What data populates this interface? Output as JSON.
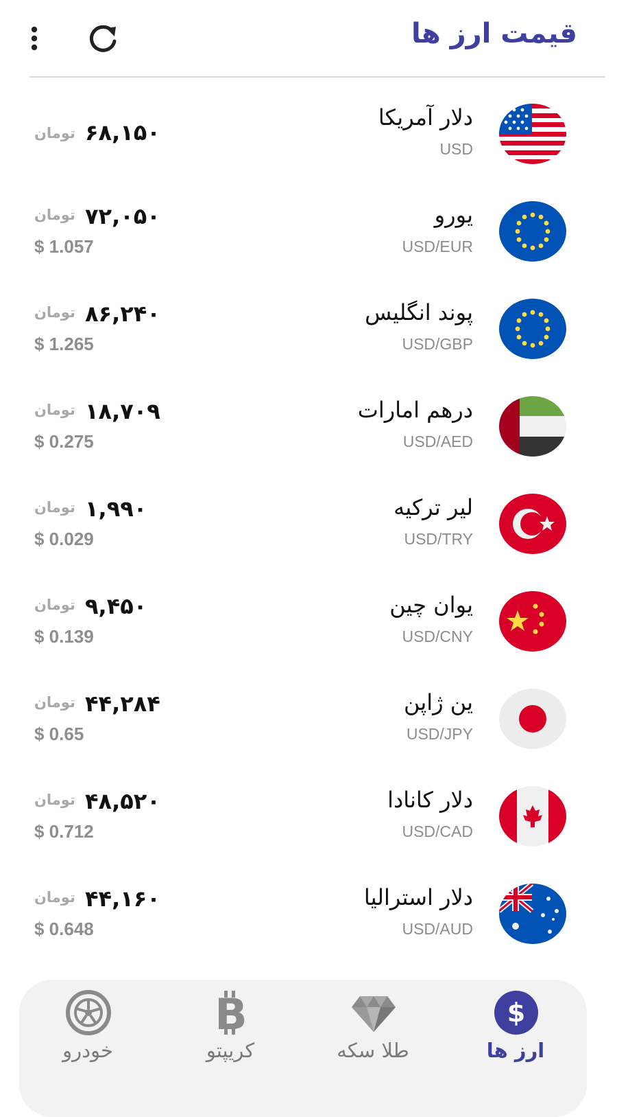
{
  "header": {
    "title": "قیمت ارز ها"
  },
  "currencies": [
    {
      "name": "دلار آمریکا",
      "code": "USD",
      "price": "۶۸,۱۵۰",
      "unit": "تومان",
      "usd": ""
    },
    {
      "name": "یورو",
      "code": "USD/EUR",
      "price": "۷۲,۰۵۰",
      "unit": "تومان",
      "usd": "$ 1.057"
    },
    {
      "name": "پوند انگلیس",
      "code": "USD/GBP",
      "price": "۸۶,۲۴۰",
      "unit": "تومان",
      "usd": "$ 1.265"
    },
    {
      "name": "درهم امارات",
      "code": "USD/AED",
      "price": "۱۸,۷۰۹",
      "unit": "تومان",
      "usd": "$ 0.275"
    },
    {
      "name": "لیر ترکیه",
      "code": "USD/TRY",
      "price": "۱,۹۹۰",
      "unit": "تومان",
      "usd": "$ 0.029"
    },
    {
      "name": "یوان چین",
      "code": "USD/CNY",
      "price": "۹,۴۵۰",
      "unit": "تومان",
      "usd": "$ 0.139"
    },
    {
      "name": "ین ژاپن",
      "code": "USD/JPY",
      "price": "۴۴,۲۸۴",
      "unit": "تومان",
      "usd": "$ 0.65"
    },
    {
      "name": "دلار کانادا",
      "code": "USD/CAD",
      "price": "۴۸,۵۲۰",
      "unit": "تومان",
      "usd": "$ 0.712"
    },
    {
      "name": "دلار استرالیا",
      "code": "USD/AUD",
      "price": "۴۴,۱۶۰",
      "unit": "تومان",
      "usd": "$ 0.648"
    }
  ],
  "flags": [
    "us-flag-icon",
    "eu-flag-icon",
    "eu-flag-icon",
    "uae-flag-icon",
    "turkey-flag-icon",
    "china-flag-icon",
    "japan-flag-icon",
    "canada-flag-icon",
    "australia-flag-icon"
  ],
  "bottom_nav": [
    {
      "label": "ارز ها",
      "icon": "dollar-icon",
      "active": true
    },
    {
      "label": "طلا سکه",
      "icon": "diamond-icon",
      "active": false
    },
    {
      "label": "کریپتو",
      "icon": "bitcoin-icon",
      "active": false
    },
    {
      "label": "خودرو",
      "icon": "wheel-icon",
      "active": false
    }
  ],
  "colors": {
    "accent": "#3f3f9f",
    "nav_background": "#f2f2f2",
    "muted_text": "#8c8c8c"
  }
}
